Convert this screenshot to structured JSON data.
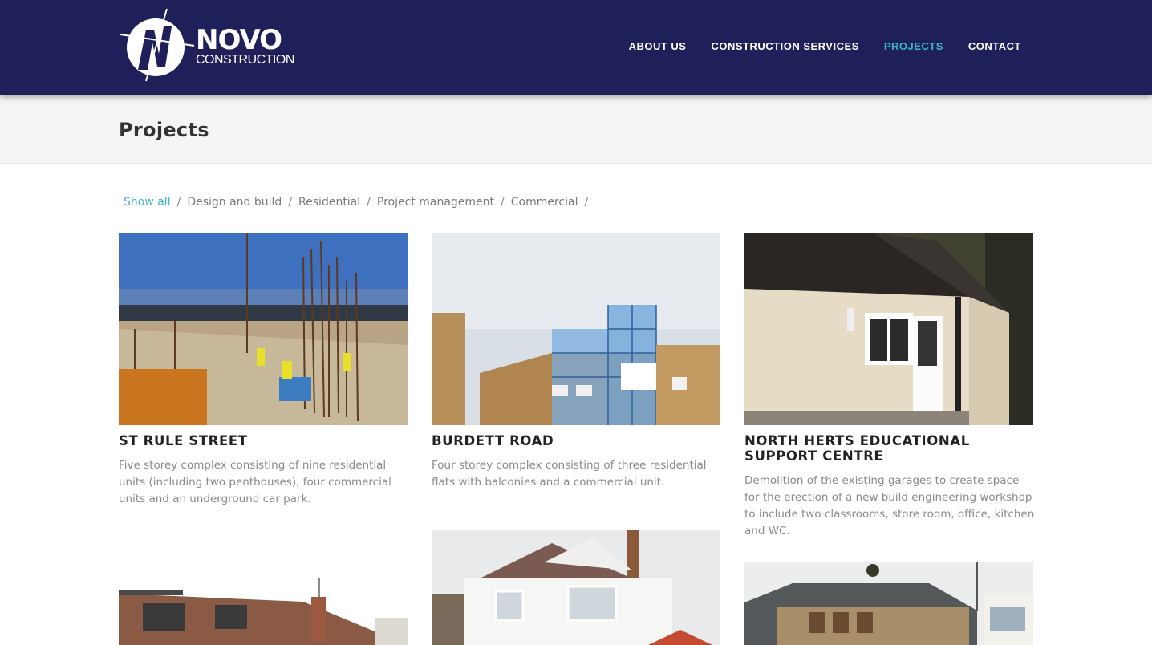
{
  "brand": {
    "name": "NOVO",
    "tagline": "CONSTRUCTION",
    "colors": {
      "header_bg": "#1f1f5a",
      "accent": "#3fb4c6"
    }
  },
  "nav": {
    "items": [
      {
        "label": "ABOUT US"
      },
      {
        "label": "CONSTRUCTION SERVICES"
      },
      {
        "label": "PROJECTS",
        "active": true
      },
      {
        "label": "CONTACT"
      }
    ]
  },
  "page": {
    "title": "Projects"
  },
  "filters": {
    "items": [
      {
        "label": "Show all",
        "active": true
      },
      {
        "label": "Design and build"
      },
      {
        "label": "Residential"
      },
      {
        "label": "Project management"
      },
      {
        "label": "Commercial"
      }
    ],
    "separator": "/"
  },
  "projects": [
    {
      "title": "ST RULE STREET",
      "description": "Five storey complex consisting of nine residential units (including two penthouses), four commercial units and an underground car park.",
      "image": "construction-site-photo"
    },
    {
      "title": "BURDETT ROAD",
      "description": "Four storey complex consisting of three residential flats with balconies and a commercial unit.",
      "image": "scaffolded-brick-building-photo"
    },
    {
      "title": "NORTH HERTS EDUCATIONAL SUPPORT CENTRE",
      "description": "Demolition of the existing garages to create space for the erection of a new build engineering workshop to include two classrooms, store room, office, kitchen and WC.",
      "image": "rendered-workshop-building-photo"
    },
    {
      "image": "terraced-roofs-photo"
    },
    {
      "image": "white-house-photo"
    },
    {
      "image": "brick-extension-photo"
    }
  ]
}
